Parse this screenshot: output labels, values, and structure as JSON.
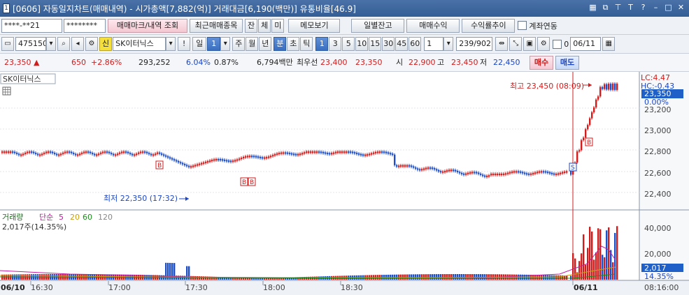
{
  "window": {
    "title": "[0606] 자동일지차트(매매내역) - 시가총액[7,882(억)] 거래대금[6,190(백만)] 유통비율[46.9]",
    "app_icon": "1"
  },
  "toolbar1": {
    "account": "****-**21",
    "password": "********",
    "trade_mark_btn": "매매마크/내역 조회",
    "recent_btn": "최근매매종목",
    "jan": "잔",
    "che": "체",
    "mi": "미",
    "memo_btn": "메모보기",
    "daily_btn": "일별잔고",
    "profit_btn": "매매수익",
    "rate_btn": "수익률추이",
    "link_label": "계좌연동"
  },
  "toolbar2": {
    "code": "475150",
    "sin": "신",
    "name": "SK이터닉스",
    "excl": "!",
    "period": "일",
    "period_num": "1",
    "ju": "주",
    "wol": "월",
    "nyeon": "년",
    "bun": "분",
    "cho": "초",
    "tik": "틱",
    "intervals": [
      "1",
      "3",
      "5",
      "10",
      "15",
      "30",
      "45",
      "60"
    ],
    "sel_interval": "1",
    "count": "1",
    "paging": "239/902",
    "date": "06/11",
    "chk_label": "0"
  },
  "quote": {
    "price": "23,350",
    "arrow": "▲",
    "change": "650",
    "rate": "+2.86%",
    "volume": "293,252",
    "vol_rate": "6.04%",
    "turnover": "0.87%",
    "amount": "6,794백만",
    "best_label": "최우선",
    "best_ask": "23,400",
    "best_bid": "23,350",
    "open_label": "시",
    "open": "22,900",
    "high_label": "고",
    "high": "23,450",
    "low_label": "저",
    "low": "22,450",
    "buy_btn": "매수",
    "sell_btn": "매도"
  },
  "chart": {
    "stock_label": "SK이터닉스",
    "lc": "LC:4.47",
    "hc": "HC:-0.43",
    "cur_price": "23,350",
    "cur_rate": "0.00%",
    "y_ticks": [
      "23,200",
      "23,000",
      "22,800",
      "22,600",
      "22,400"
    ],
    "max_label": "최고 23,450 (08:09)",
    "min_label": "최저 22,350 (17:32)",
    "vol_title": "거래량",
    "vol_ma_label": "단순",
    "ma": [
      "5",
      "20",
      "60",
      "120"
    ],
    "vol_info": "2,017주(14.35%)",
    "vol_ticks": [
      "40,000",
      "20,000"
    ],
    "cur_vol": "2,017",
    "cur_vol_rate": "14.35%",
    "x_ticks": [
      "06/10",
      "16:30",
      "17:00",
      "17:30",
      "18:00",
      "18:30",
      "06/11"
    ],
    "x_time": "08:16:00",
    "marks": [
      "B",
      "B",
      "B",
      "S",
      "B"
    ]
  }
}
